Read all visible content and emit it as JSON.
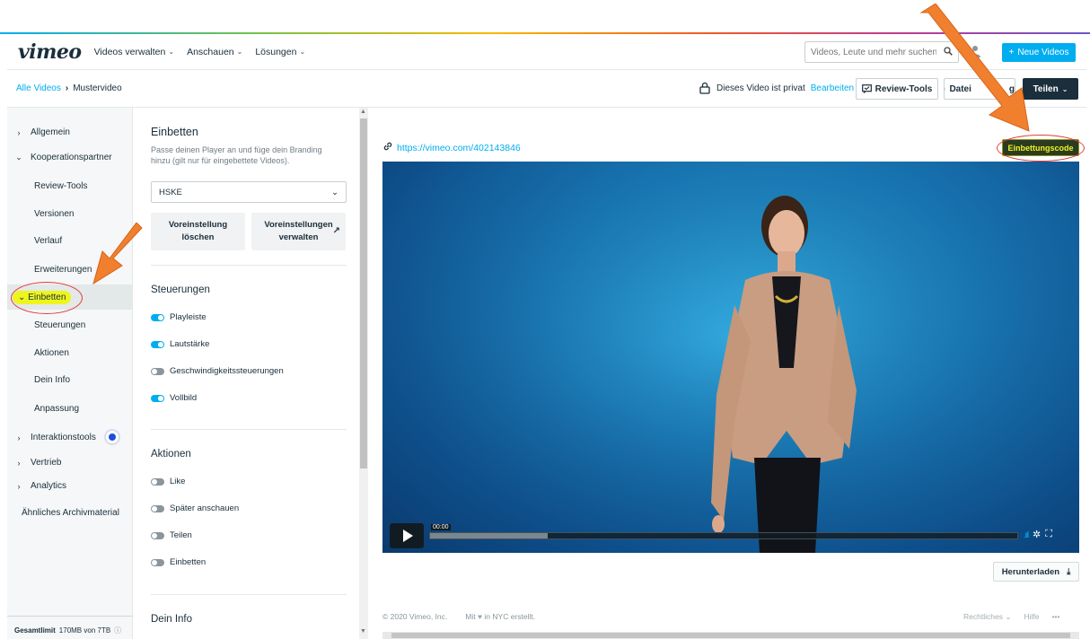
{
  "header": {
    "logo": "vimeo",
    "nav": [
      "Videos verwalten",
      "Anschauen",
      "Lösungen"
    ],
    "search_placeholder": "Videos, Leute und mehr suchen",
    "new_video_label": "Neue Videos"
  },
  "subheader": {
    "breadcrumb_link": "Alle Videos",
    "breadcrumb_current": "Mustervideo",
    "privacy_text": "Dieses Video ist privat",
    "edit_link": "Bearbeiten",
    "review_tools_label": "Review-Tools",
    "file_label": "Datei",
    "file_label_suffix": "g",
    "share_label": "Teilen"
  },
  "sidebar": {
    "items": [
      {
        "label": "Allgemein"
      },
      {
        "label": "Kooperationspartner"
      },
      {
        "label": "Review-Tools"
      },
      {
        "label": "Versionen"
      },
      {
        "label": "Verlauf"
      },
      {
        "label": "Erweiterungen"
      },
      {
        "label": "Einbetten"
      },
      {
        "label": "Steuerungen"
      },
      {
        "label": "Aktionen"
      },
      {
        "label": "Dein Info"
      },
      {
        "label": "Anpassung"
      },
      {
        "label": "Interaktionstools"
      },
      {
        "label": "Vertrieb"
      },
      {
        "label": "Analytics"
      },
      {
        "label": "Ähnliches Archivmaterial"
      }
    ],
    "storage_label": "Gesamtlimit",
    "storage_value": "170MB von 7TB"
  },
  "panel": {
    "title": "Einbetten",
    "description": "Passe deinen Player an und füge dein Branding hinzu (gilt nur für eingebettete Videos).",
    "preset_selected": "HSKE",
    "delete_preset_line1": "Voreinstellung",
    "delete_preset_line2": "löschen",
    "manage_presets_line1": "Voreinstellungen",
    "manage_presets_line2": "verwalten",
    "controls_title": "Steuerungen",
    "controls": [
      {
        "label": "Playleiste",
        "on": true
      },
      {
        "label": "Lautstärke",
        "on": true
      },
      {
        "label": "Geschwindigkeitssteuerungen",
        "on": false
      },
      {
        "label": "Vollbild",
        "on": true
      }
    ],
    "actions_title": "Aktionen",
    "actions": [
      {
        "label": "Like",
        "on": false
      },
      {
        "label": "Später anschauen",
        "on": false
      },
      {
        "label": "Teilen",
        "on": false
      },
      {
        "label": "Einbetten",
        "on": false
      }
    ],
    "info_title": "Dein Info"
  },
  "content": {
    "video_url": "https://vimeo.com/402143846",
    "embed_code_label": "Einbettungscode",
    "time": "00:00",
    "buffered_fraction": 0.2,
    "download_label": "Herunterladen"
  },
  "footer": {
    "copyright": "© 2020 Vimeo, Inc.",
    "made_prefix": "Mit",
    "made_suffix": "in NYC erstellt.",
    "legal": "Rechtliches",
    "help": "Hilfe",
    "more": "•••"
  },
  "colors": {
    "accent": "#00adef",
    "dark": "#1a2e3b",
    "highlight": "#eef51e",
    "annotation_arrow": "#f07f2e",
    "annotation_circle": "#e23c3c"
  }
}
